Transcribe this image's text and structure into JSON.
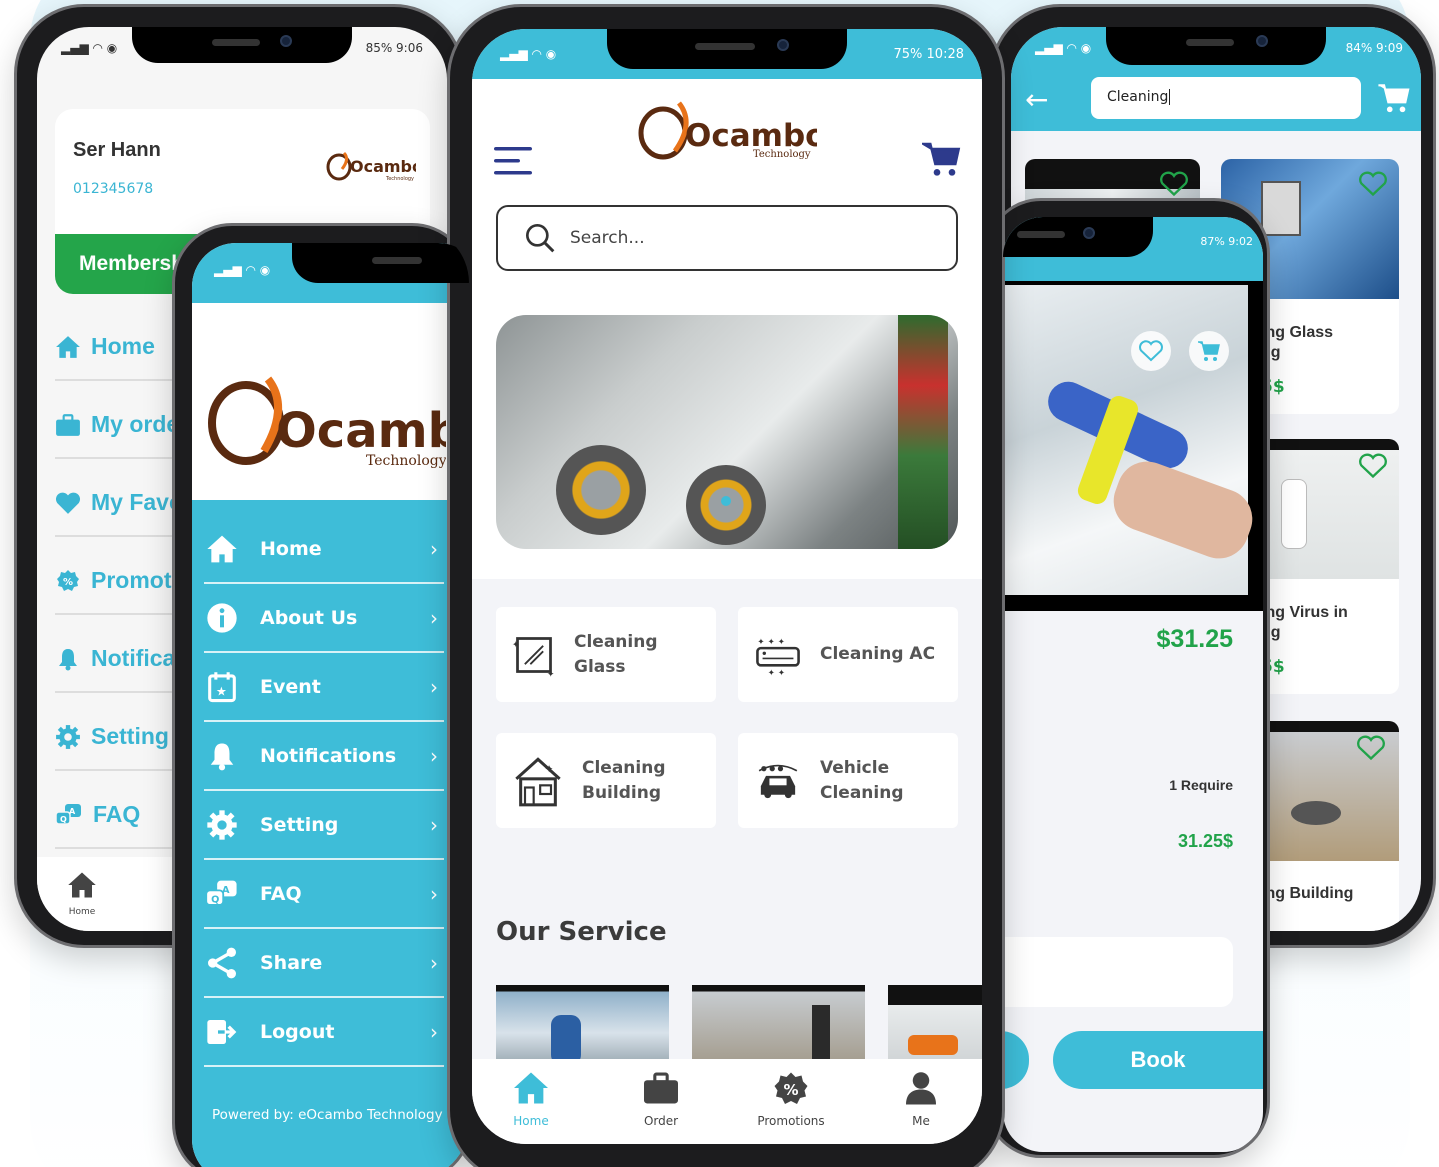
{
  "colors": {
    "brand_teal": "#3ebdd8",
    "brand_brown": "#5a2a10",
    "accent_orange": "#e8731a",
    "price_green": "#21a34a",
    "membership_green": "#24a54a",
    "cart_navy": "#2d3a8c"
  },
  "brand": {
    "name": "Ocambo",
    "sub": "Technology"
  },
  "phoneA": {
    "status_right": "85%  9:06",
    "user_name": "Ser Hann",
    "user_phone": "012345678",
    "membership_label": "Membershi",
    "menu": [
      {
        "label": "Home",
        "icon": "home-icon"
      },
      {
        "label": "My orde",
        "icon": "briefcase-icon"
      },
      {
        "label": "My Favo",
        "icon": "heart-icon"
      },
      {
        "label": "Promoti",
        "icon": "percent-badge-icon"
      },
      {
        "label": "Notifica",
        "icon": "bell-icon"
      },
      {
        "label": "Setting",
        "icon": "gear-icon"
      },
      {
        "label": "FAQ",
        "icon": "faq-icon"
      }
    ],
    "bottom_tab": "Home"
  },
  "phoneB": {
    "menu": [
      {
        "label": "Home",
        "icon": "home-icon"
      },
      {
        "label": "About Us",
        "icon": "info-icon"
      },
      {
        "label": "Event",
        "icon": "calendar-icon"
      },
      {
        "label": "Notifications",
        "icon": "bell-icon"
      },
      {
        "label": "Setting",
        "icon": "gear-icon"
      },
      {
        "label": "FAQ",
        "icon": "faq-icon"
      },
      {
        "label": "Share",
        "icon": "share-icon"
      },
      {
        "label": "Logout",
        "icon": "logout-icon"
      }
    ],
    "footer": "Powered by: eOcambo Technology"
  },
  "phoneC": {
    "status_right": "75%  10:28",
    "search_placeholder": "Search...",
    "categories": [
      {
        "line1": "Cleaning",
        "line2": "Glass",
        "icon": "glass-icon"
      },
      {
        "line1": "Cleaning AC",
        "line2": "",
        "icon": "ac-icon"
      },
      {
        "line1": "Cleaning",
        "line2": "Building",
        "icon": "building-icon"
      },
      {
        "line1": "Vehicle",
        "line2": "Cleaning",
        "icon": "car-wash-icon"
      }
    ],
    "section_title": "Our Service",
    "tabs": [
      {
        "label": "Home",
        "icon": "home-icon",
        "active": true
      },
      {
        "label": "Order",
        "icon": "briefcase-icon",
        "active": false
      },
      {
        "label": "Promotions",
        "icon": "percent-badge-icon",
        "active": false
      },
      {
        "label": "Me",
        "icon": "person-icon",
        "active": false
      }
    ]
  },
  "phoneD": {
    "status_right": "84%  9:09",
    "search_value": "Cleaning",
    "results": [
      {
        "title_line1": "ing Glass",
        "title_line2": "ng",
        "price": "5$"
      },
      {
        "title_line1": "ing Virus in",
        "title_line2": "ng",
        "price": "5$"
      },
      {
        "title_line1": "ing Building",
        "title_line2": "",
        "price": ""
      }
    ]
  },
  "phoneE": {
    "status_right": "87%  9:02",
    "price": "$31.25",
    "require": "1 Require",
    "total": "31.25$",
    "book_label": "Book"
  }
}
